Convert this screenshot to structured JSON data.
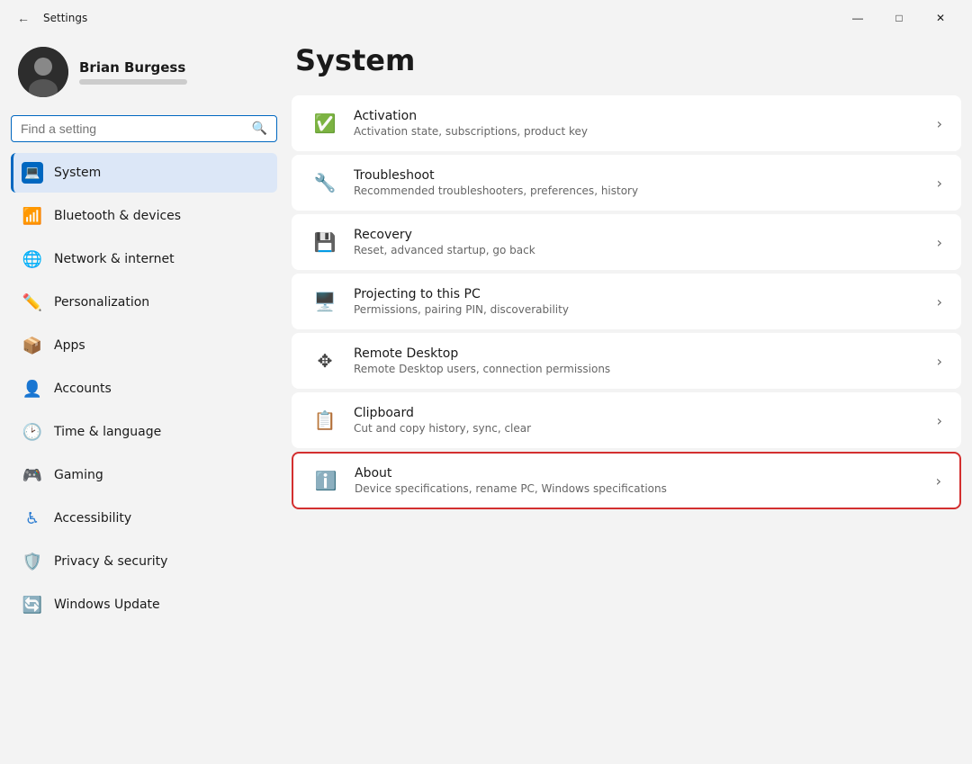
{
  "titlebar": {
    "title": "Settings",
    "minimize": "—",
    "maximize": "□",
    "close": "✕"
  },
  "user": {
    "name": "Brian Burgess"
  },
  "search": {
    "placeholder": "Find a setting"
  },
  "sidebar": {
    "items": [
      {
        "id": "system",
        "label": "System",
        "active": true
      },
      {
        "id": "bluetooth",
        "label": "Bluetooth & devices",
        "active": false
      },
      {
        "id": "network",
        "label": "Network & internet",
        "active": false
      },
      {
        "id": "personalization",
        "label": "Personalization",
        "active": false
      },
      {
        "id": "apps",
        "label": "Apps",
        "active": false
      },
      {
        "id": "accounts",
        "label": "Accounts",
        "active": false
      },
      {
        "id": "time",
        "label": "Time & language",
        "active": false
      },
      {
        "id": "gaming",
        "label": "Gaming",
        "active": false
      },
      {
        "id": "accessibility",
        "label": "Accessibility",
        "active": false
      },
      {
        "id": "privacy",
        "label": "Privacy & security",
        "active": false
      },
      {
        "id": "update",
        "label": "Windows Update",
        "active": false
      }
    ]
  },
  "main": {
    "title": "System",
    "settings": [
      {
        "id": "activation",
        "title": "Activation",
        "subtitle": "Activation state, subscriptions, product key",
        "highlighted": false
      },
      {
        "id": "troubleshoot",
        "title": "Troubleshoot",
        "subtitle": "Recommended troubleshooters, preferences, history",
        "highlighted": false
      },
      {
        "id": "recovery",
        "title": "Recovery",
        "subtitle": "Reset, advanced startup, go back",
        "highlighted": false
      },
      {
        "id": "projecting",
        "title": "Projecting to this PC",
        "subtitle": "Permissions, pairing PIN, discoverability",
        "highlighted": false
      },
      {
        "id": "remote-desktop",
        "title": "Remote Desktop",
        "subtitle": "Remote Desktop users, connection permissions",
        "highlighted": false
      },
      {
        "id": "clipboard",
        "title": "Clipboard",
        "subtitle": "Cut and copy history, sync, clear",
        "highlighted": false
      },
      {
        "id": "about",
        "title": "About",
        "subtitle": "Device specifications, rename PC, Windows specifications",
        "highlighted": true
      }
    ]
  }
}
